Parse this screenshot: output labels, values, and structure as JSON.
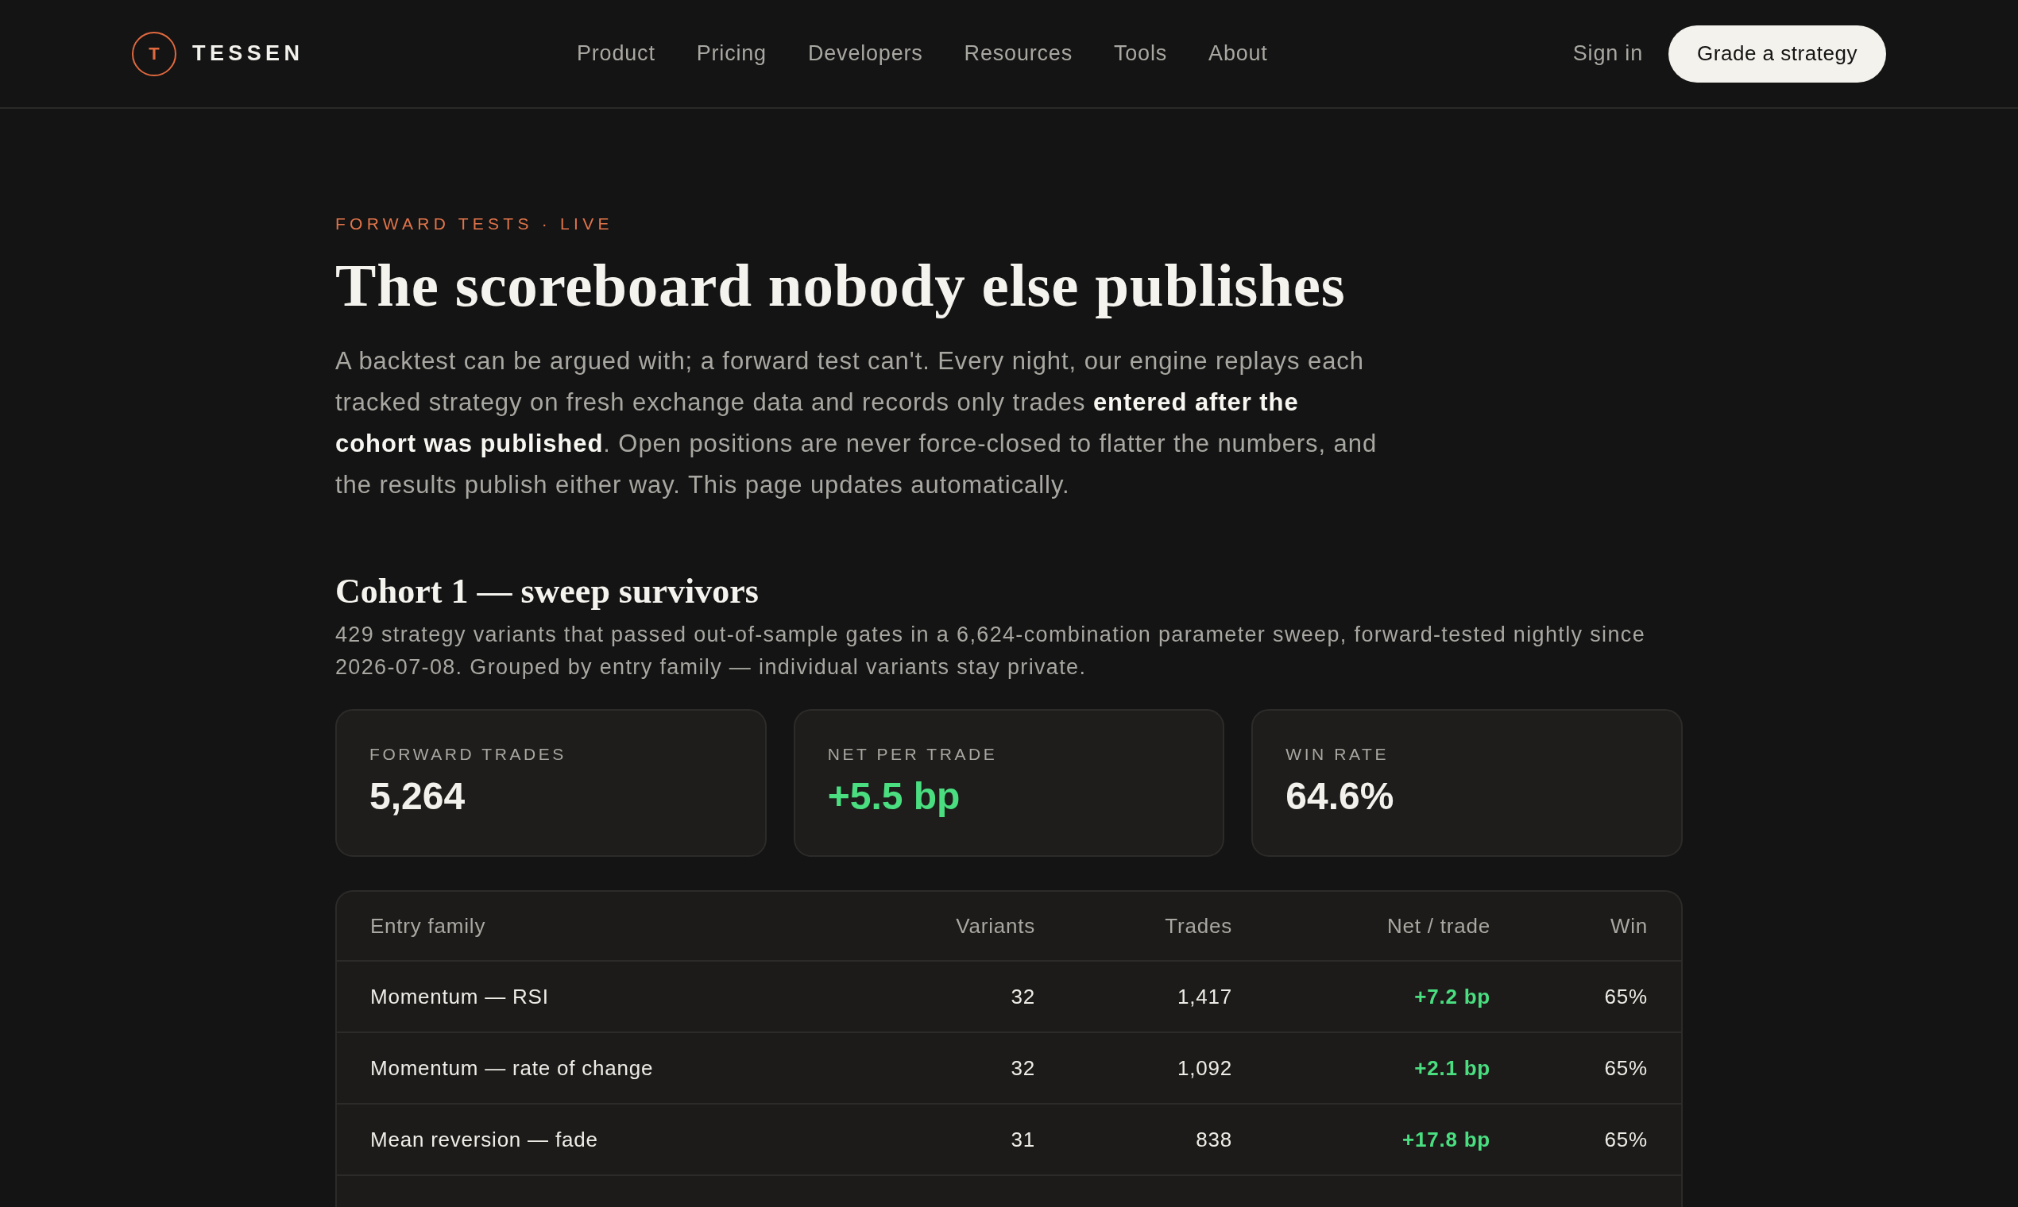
{
  "header": {
    "logo": {
      "mark": "T",
      "wordmark": "TESSEN"
    },
    "nav": [
      "Product",
      "Pricing",
      "Developers",
      "Resources",
      "Tools",
      "About"
    ],
    "sign_in": "Sign in",
    "cta": "Grade a strategy"
  },
  "hero": {
    "eyebrow": "FORWARD TESTS · LIVE",
    "title": "The scoreboard nobody else publishes",
    "intro": "A backtest can be argued with; a forward test can't. Every night, our engine replays each tracked strategy on fresh exchange data and records only trades **entered after the cohort was published**. Open positions are never force-closed to flatter the numbers, and the results publish either way. This page updates automatically."
  },
  "cohort": {
    "title": "Cohort 1 — sweep survivors",
    "description": "429 strategy variants that passed out-of-sample gates in a 6,624-combination parameter sweep, forward-tested nightly since 2026-07-08. Grouped by entry family — individual variants stay private.",
    "stats": [
      {
        "label": "FORWARD TRADES",
        "value": "5,264",
        "color": "#f3f1ec"
      },
      {
        "label": "NET PER TRADE",
        "value": "+5.5 bp",
        "color": "#4ade80"
      },
      {
        "label": "WIN RATE",
        "value": "64.6%",
        "color": "#f3f1ec"
      }
    ],
    "table": {
      "columns": [
        "Entry family",
        "Variants",
        "Trades",
        "Net / trade",
        "Win"
      ],
      "rows": [
        {
          "cells": [
            "Momentum — RSI",
            "32",
            "1,417",
            "+7.2 bp",
            "65%"
          ]
        },
        {
          "cells": [
            "Momentum — rate of change",
            "32",
            "1,092",
            "+2.1 bp",
            "65%"
          ]
        },
        {
          "cells": [
            "Mean reversion — fade",
            "31",
            "838",
            "+17.8 bp",
            "65%"
          ]
        }
      ]
    }
  }
}
